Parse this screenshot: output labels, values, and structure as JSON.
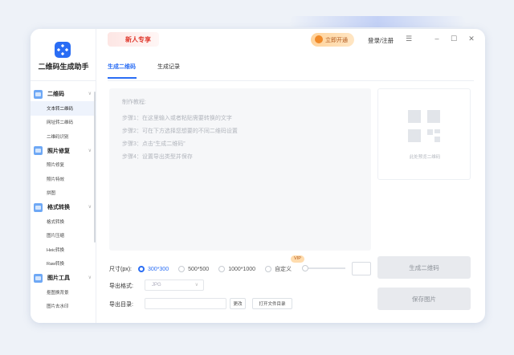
{
  "app": {
    "title": "二维码生成助手"
  },
  "sidebar": {
    "categories": [
      {
        "label": "二维码",
        "items": [
          "文本转二维码",
          "网址转二维码",
          "二维码识别"
        ]
      },
      {
        "label": "照片修复",
        "items": [
          "照片修复",
          "照片特效",
          "拼图"
        ]
      },
      {
        "label": "格式转换",
        "items": [
          "格式转换",
          "图片压缩",
          "Heic转换",
          "Raw转换"
        ]
      },
      {
        "label": "图片工具",
        "items": [
          "抠图换背景",
          "图片去水印"
        ]
      }
    ],
    "active_item": "文本转二维码"
  },
  "topbar": {
    "promo_label": "新人专享",
    "open_vip_label": "立即开通",
    "login_label": "登录/注册",
    "menu_icon": "hamburger-icon",
    "minimize_icon": "minimize-icon",
    "maximize_icon": "maximize-icon",
    "close_icon": "close-icon"
  },
  "tabs": [
    {
      "label": "生成二维码",
      "active": true
    },
    {
      "label": "生成记录",
      "active": false
    }
  ],
  "editor": {
    "tutorial_title": "制作教程:",
    "steps": [
      "步骤1：在这里输入或者粘贴需要转换的文字",
      "步骤2：可在下方选择您想要的不同二维码设置",
      "步骤3：点击“生成二维码”",
      "步骤4：设置导出类型并保存"
    ]
  },
  "preview": {
    "placeholder": "此处预览二维码"
  },
  "options": {
    "size_label": "尺寸(px):",
    "sizes": [
      {
        "label": "300*300",
        "selected": true
      },
      {
        "label": "500*500",
        "selected": false
      },
      {
        "label": "1000*1000",
        "selected": false
      },
      {
        "label": "自定义",
        "selected": false
      }
    ],
    "vip_badge": "VIP",
    "format_label": "导出格式:",
    "format_value": "JPG",
    "dir_label": "导出目录:",
    "change_label": "更改",
    "open_dir_label": "打开文件目录"
  },
  "actions": {
    "generate_label": "生成二维码",
    "save_label": "保存图片"
  },
  "colors": {
    "accent": "#2a6df4",
    "promo": "#e03a2e",
    "vip": "#f08a2a"
  }
}
